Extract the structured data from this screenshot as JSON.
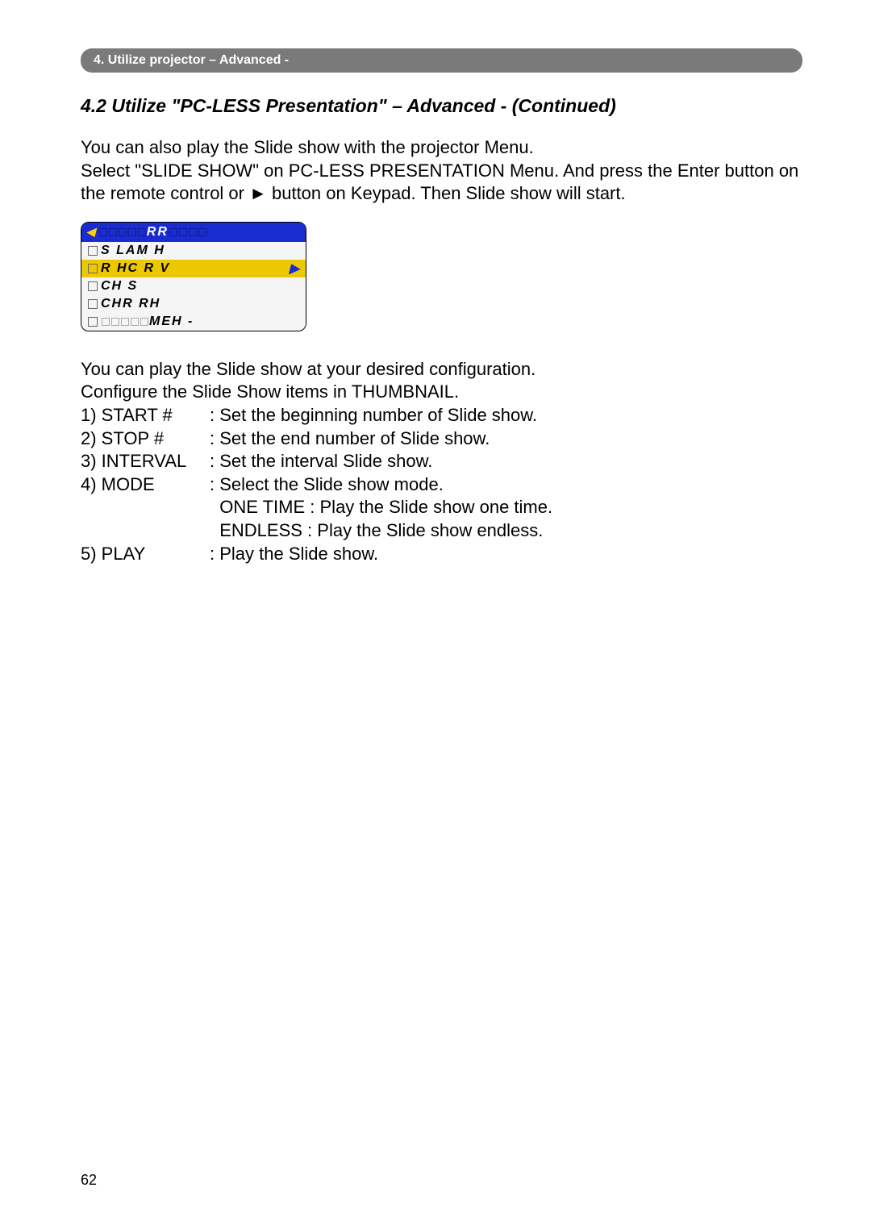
{
  "header": {
    "section_tab": "4. Utilize projector – Advanced -"
  },
  "title": "4.2 Utilize \"PC-LESS Presentation\" – Advanced - (Continued)",
  "intro_paragraph": "You can also play the Slide show with the projector Menu.\nSelect \"SLIDE SHOW\" on PC-LESS PRESENTATION Menu. And press the Enter button on the remote control or ► button on Keypad.  Then Slide show will start.",
  "menu": {
    "header_text": "RR",
    "row1": "S   LAM  H",
    "row2": "R  HC   R   V",
    "row3": "CH     S",
    "row4": "CHR       RH",
    "row5": "MEH  -"
  },
  "config_intro_1": "You can play the Slide show at your desired configuration.",
  "config_intro_2": "Configure the Slide Show items in THUMBNAIL.",
  "items": [
    {
      "key": "1) START #",
      "val": ": Set the beginning number of Slide show."
    },
    {
      "key": "2) STOP #",
      "val": ": Set the end number of Slide show."
    },
    {
      "key": "3) INTERVAL",
      "val": ": Set the interval Slide show."
    },
    {
      "key": "4) MODE",
      "val": ": Select the Slide show mode."
    },
    {
      "key": "",
      "val": "  ONE TIME : Play the Slide show one time."
    },
    {
      "key": "",
      "val": "  ENDLESS : Play the Slide show endless."
    },
    {
      "key": "5) PLAY",
      "val": ": Play the Slide show."
    }
  ],
  "page_number": "62"
}
